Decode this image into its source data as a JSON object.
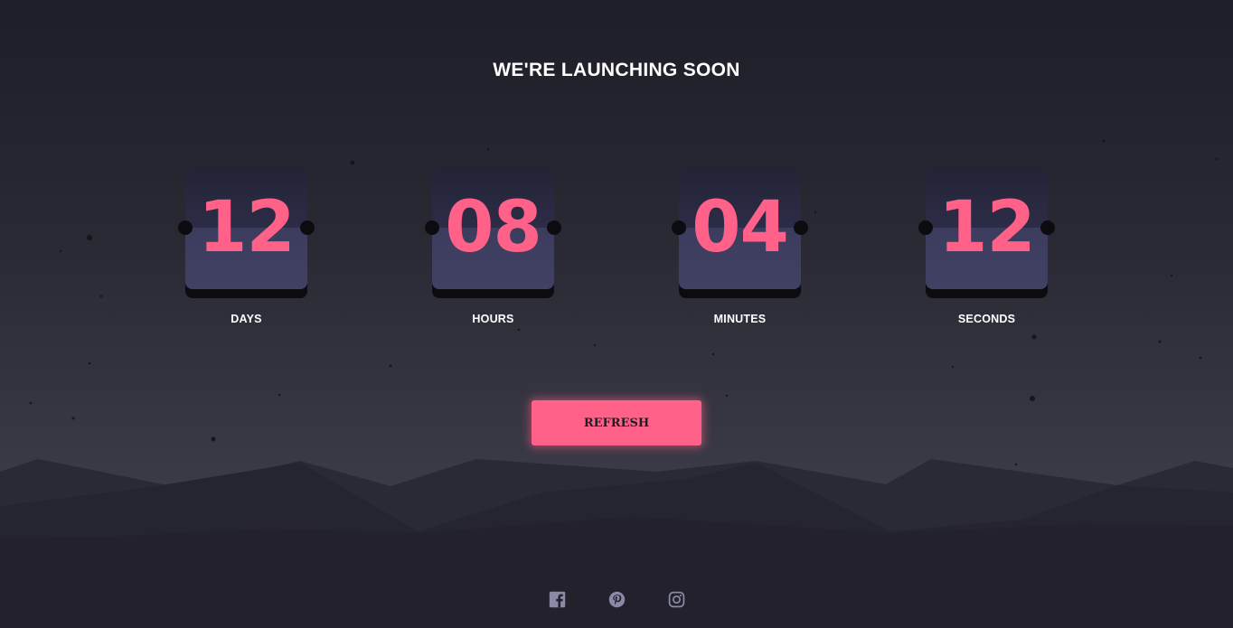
{
  "header": {
    "title": "WE'RE LAUNCHING SOON"
  },
  "countdown": [
    {
      "value": "12",
      "label": "DAYS"
    },
    {
      "value": "08",
      "label": "HOURS"
    },
    {
      "value": "04",
      "label": "MINUTES"
    },
    {
      "value": "12",
      "label": "SECONDS"
    }
  ],
  "actions": {
    "refresh_label": "REFRESH"
  },
  "social": [
    {
      "icon": "facebook-icon"
    },
    {
      "icon": "pinterest-icon"
    },
    {
      "icon": "instagram-icon"
    }
  ],
  "colors": {
    "accent": "#ff6188",
    "background_top": "#1e1e28",
    "card": "#2c2c46",
    "social_icon": "#8a8aa6"
  }
}
